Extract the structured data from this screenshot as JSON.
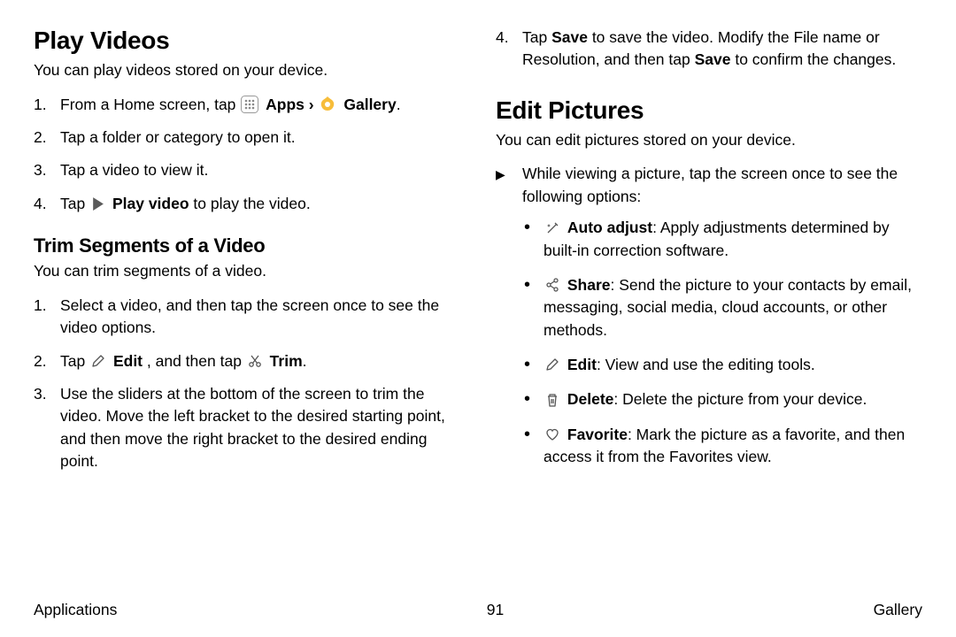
{
  "left": {
    "h1": "Play Videos",
    "p1": "You can play videos stored on your device.",
    "step1a": "From a Home screen, tap ",
    "apps_label": "Apps",
    "gallery_label": "Gallery",
    "period": ".",
    "chevron": " › ",
    "step2": "Tap a folder or category to open it.",
    "step3": "Tap a video to view it.",
    "step4a": "Tap ",
    "play_label": "Play video",
    "step4b": " to play the video.",
    "h2": "Trim Segments of a Video",
    "p2": "You can trim segments of a video.",
    "t1": "Select a video, and then tap the screen once to see the video options.",
    "t2a": "Tap ",
    "edit_label": "Edit",
    "t2b": ", and then tap ",
    "trim_label": "Trim",
    "t3": "Use the sliders at the bottom of the screen to trim the video. Move the left bracket to the desired starting point, and then move the right bracket to the desired ending point."
  },
  "right": {
    "cont4a": "Tap ",
    "save1": "Save",
    "cont4b": " to save the video. Modify the File name or Resolution, and then tap ",
    "save2": "Save",
    "cont4c": " to confirm the changes.",
    "h1": "Edit Pictures",
    "p1": "You can edit pictures stored on your device.",
    "tri": "While viewing a picture, tap the screen once to see the following options:",
    "auto_label": "Auto adjust",
    "auto_rest": ": Apply adjustments determined by built-in correction software.",
    "share_label": "Share",
    "share_rest": ": Send the picture to your contacts by email, messaging, social media, cloud accounts, or other methods.",
    "edit_label": "Edit",
    "edit_rest": ": View and use the editing tools.",
    "delete_label": "Delete",
    "delete_rest": ": Delete the picture from your device.",
    "fav_label": "Favorite",
    "fav_rest": ": Mark the picture as a favorite, and then access it from the Favorites view."
  },
  "footer": {
    "left": "Applications",
    "center": "91",
    "right": "Gallery"
  }
}
